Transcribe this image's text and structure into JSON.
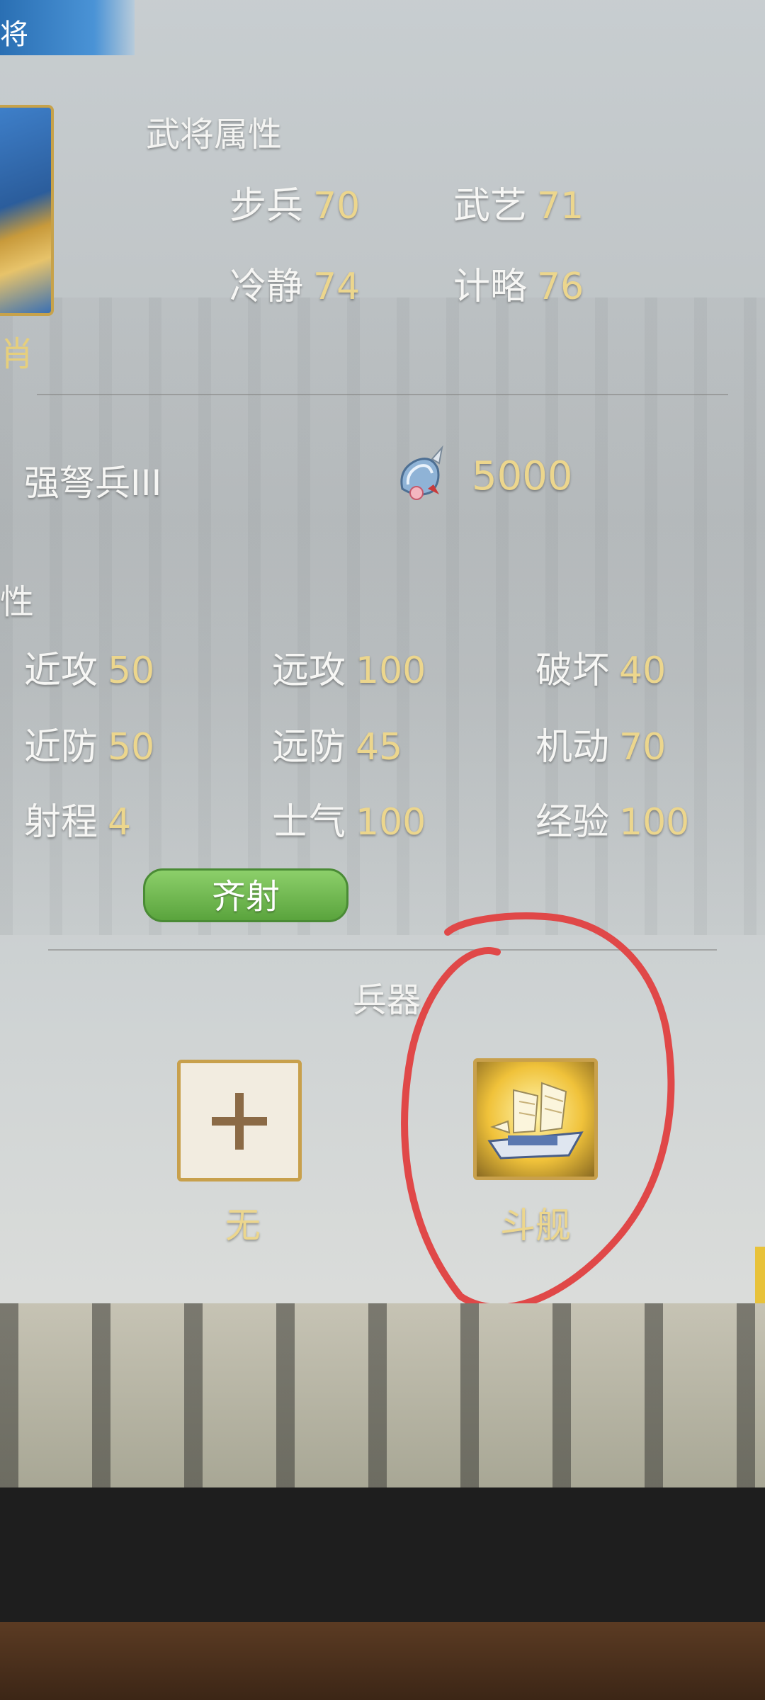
{
  "title_fragment": "将",
  "hero": {
    "name_fragment": "肖",
    "attributes_title": "武将属性",
    "attributes": [
      {
        "label": "步兵",
        "value": "70"
      },
      {
        "label": "武艺",
        "value": "71"
      },
      {
        "label": "冷静",
        "value": "74"
      },
      {
        "label": "计略",
        "value": "76"
      }
    ]
  },
  "unit": {
    "name": "强弩兵III",
    "troop_icon": "troop-helmet-icon",
    "count": "5000"
  },
  "unit_attributes_title_fragment": "性",
  "unit_attributes": [
    {
      "label": "近攻",
      "value": "50"
    },
    {
      "label": "远攻",
      "value": "100"
    },
    {
      "label": "破坏",
      "value": "40"
    },
    {
      "label": "近防",
      "value": "50"
    },
    {
      "label": "远防",
      "value": "45"
    },
    {
      "label": "机动",
      "value": "70"
    },
    {
      "label": "射程",
      "value": "4"
    },
    {
      "label": "士气",
      "value": "100"
    },
    {
      "label": "经验",
      "value": "100"
    }
  ],
  "skill_button": "齐射",
  "weapons": {
    "title": "兵器",
    "slots": [
      {
        "label": "无",
        "icon": "plus-icon"
      },
      {
        "label": "斗舰",
        "icon": "warship-icon"
      }
    ]
  },
  "colors": {
    "value_gold": "#ecd68d",
    "skill_green": "#6fbd4f",
    "slot_border": "#c8a04c",
    "annotation_red": "#e04848"
  }
}
